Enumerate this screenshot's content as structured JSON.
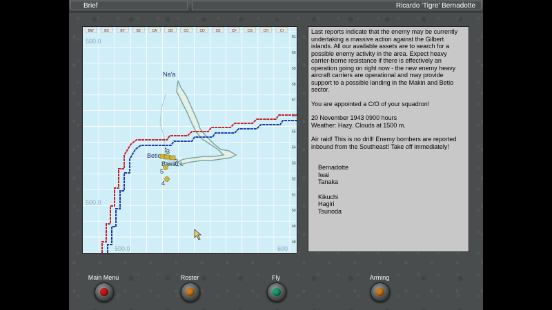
{
  "window": {
    "tab_left": "Brief",
    "pilot_name": "Ricardo 'Tigre' Bernadotte"
  },
  "map": {
    "columns": [
      "BW",
      "BX",
      "BY",
      "BZ",
      "CA",
      "CB",
      "CC",
      "CD",
      "CE",
      "CF",
      "CG",
      "CH",
      "CI"
    ],
    "rows": [
      "61",
      "60",
      "59",
      "58",
      "57",
      "56",
      "55",
      "54",
      "53",
      "52",
      "51",
      "50",
      "49",
      "48"
    ],
    "scale_labels": [
      "500.0",
      "500.0",
      "500.0",
      "600"
    ],
    "place_labels": [
      "Na'a",
      "Betio",
      "Bairiki I."
    ],
    "markers": [
      "1",
      "2",
      "3",
      "4",
      "5"
    ],
    "colors": {
      "water": "#cfeef8",
      "grid": "#ffffff",
      "red_line": "#c8202a",
      "blue_line": "#1e3aa8",
      "marker": "#d4b820"
    }
  },
  "brief": {
    "para1": "Last reports indicate that the enemy may be currently undertaking a massive action against the Gilbert islands. All our available assets are to search for a possible enemy activity in the area. Expect heavy carrier-borne resistance if there is effectively an operation going on right now - the new enemy heavy aircraft carriers are operational and may provide support to a possible landing in the Makin and Betio sector.",
    "para2": "You are appointed a C/O of your squadron!",
    "para3": "20 November 1943 0900 hours\nWeather: Hazy. Clouds at 1500 m.",
    "para4": "Air raid! This is no drill! Enemy bombers are reported inbound from the Southeast! Take off immediately!",
    "group1": "Bernadotte\nIwai\nTanaka",
    "group2": "Kikuchi\nHagiri\nTsunoda"
  },
  "buttons": [
    {
      "label": "Main Menu",
      "light": "#c81818"
    },
    {
      "label": "Roster",
      "light": "#d87810"
    },
    {
      "label": "Fly",
      "light": "#10a070"
    },
    {
      "label": "Arming",
      "light": "#d87810"
    }
  ]
}
